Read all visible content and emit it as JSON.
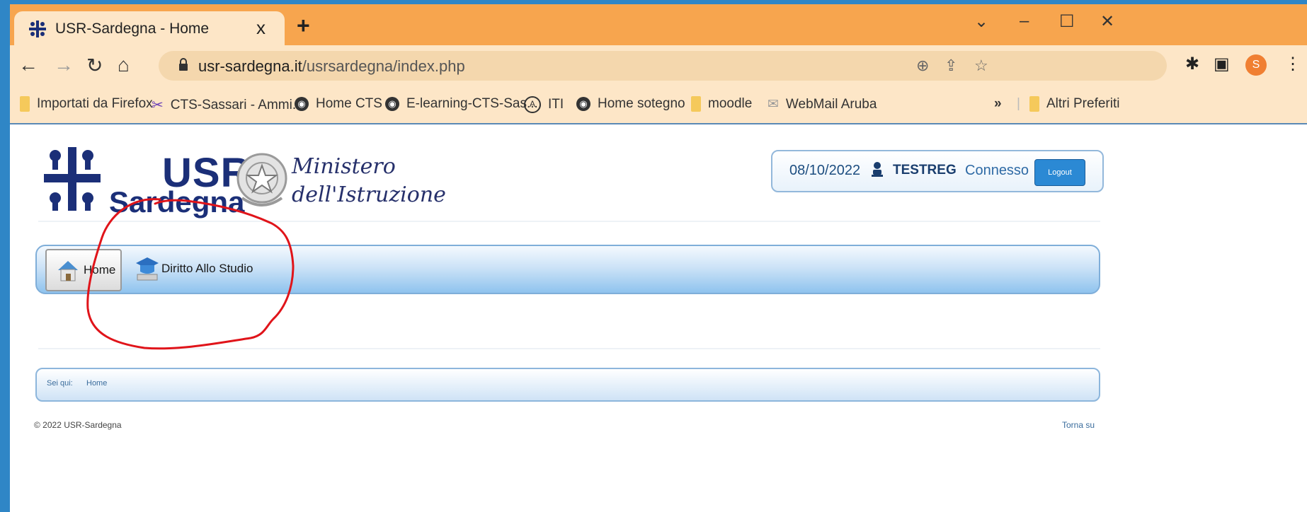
{
  "browser": {
    "tab_title": "USR-Sardegna - Home",
    "tab_close": "x",
    "new_tab": "+",
    "window_controls": {
      "dropdown": "⌄",
      "minimize": "–",
      "maximize": "☐",
      "close": "✕"
    },
    "url_domain": "usr-sardegna.it",
    "url_path": "/usrsardegna/index.php",
    "profile_initial": "S",
    "bookmarks": [
      {
        "label": "Importati da Firefox",
        "icon": "folder-icon"
      },
      {
        "label": "CTS-Sassari - Ammi...",
        "icon": "cts-icon"
      },
      {
        "label": "Home CTS",
        "icon": "globe-icon"
      },
      {
        "label": "E-learning-CTS-Sas...",
        "icon": "globe-icon"
      },
      {
        "label": "ITI",
        "icon": "iti-icon"
      },
      {
        "label": "Home sotegno",
        "icon": "globe-icon"
      },
      {
        "label": "moodle",
        "icon": "folder-icon"
      },
      {
        "label": "WebMail Aruba",
        "icon": "mail-icon"
      }
    ],
    "bookmarks_more": "»",
    "other_bookmarks": "Altri Preferiti"
  },
  "site": {
    "logo_usr": "USR",
    "logo_sardegna": "Sardegna",
    "ministero_line1": "Ministero",
    "ministero_line2": "dell'Istruzione"
  },
  "user": {
    "date": "08/10/2022",
    "username": "TESTREG",
    "status": "Connesso",
    "logout_label": "Logout"
  },
  "nav": {
    "home_label": "Home",
    "das_label": "Diritto Allo Studio"
  },
  "breadcrumb": {
    "prefix": "Sei qui:",
    "current": "Home"
  },
  "footer": {
    "copyright": "© 2022 USR-Sardegna",
    "back_to_top": "Torna su"
  },
  "colors": {
    "tab_strip": "#f7a54e",
    "toolbar": "#fde6c7",
    "nav_blue": "#8fc3ee",
    "annotation": "#e0141a"
  }
}
